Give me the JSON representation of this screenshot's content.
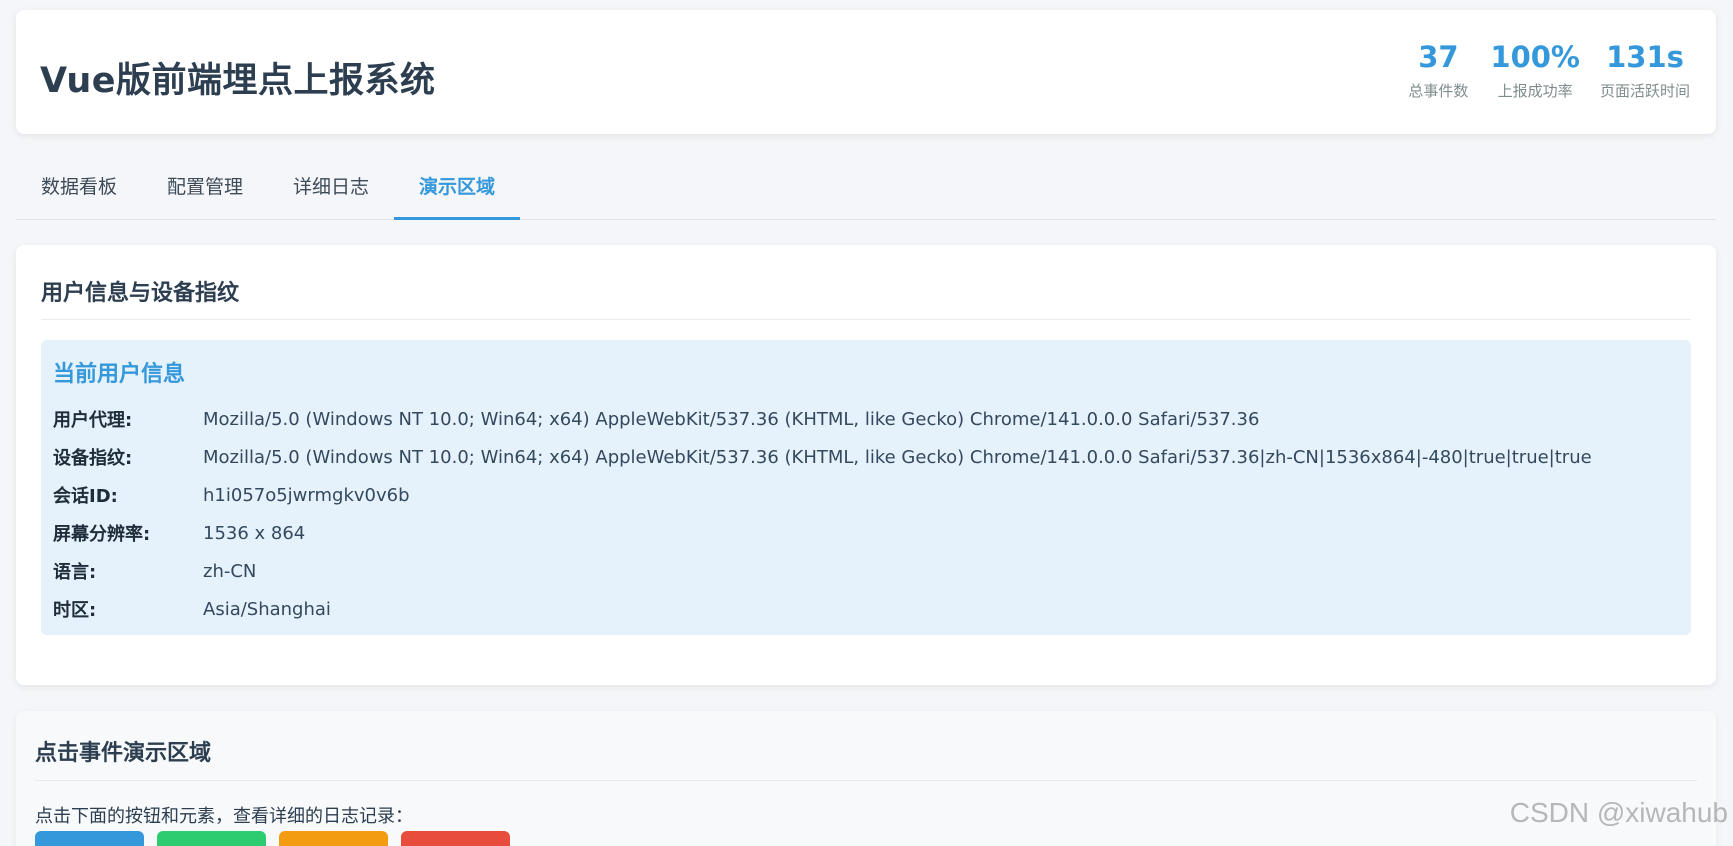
{
  "header": {
    "title": "Vue版前端埋点上报系统",
    "stats": [
      {
        "value": "37",
        "label": "总事件数"
      },
      {
        "value": "100%",
        "label": "上报成功率"
      },
      {
        "value": "131s",
        "label": "页面活跃时间"
      }
    ]
  },
  "tabs": [
    {
      "label": "数据看板"
    },
    {
      "label": "配置管理"
    },
    {
      "label": "详细日志"
    },
    {
      "label": "演示区域"
    }
  ],
  "active_tab": "演示区域",
  "user_card": {
    "title": "用户信息与设备指纹",
    "box_title": "当前用户信息",
    "rows": [
      {
        "label": "用户代理:",
        "value": "Mozilla/5.0 (Windows NT 10.0; Win64; x64) AppleWebKit/537.36 (KHTML, like Gecko) Chrome/141.0.0.0 Safari/537.36"
      },
      {
        "label": "设备指纹:",
        "value": "Mozilla/5.0 (Windows NT 10.0; Win64; x64) AppleWebKit/537.36 (KHTML, like Gecko) Chrome/141.0.0.0 Safari/537.36|zh-CN|1536x864|-480|true|true|true"
      },
      {
        "label": "会话ID:",
        "value": "h1i057o5jwrmgkv0v6b"
      },
      {
        "label": "屏幕分辨率:",
        "value": "1536 x 864"
      },
      {
        "label": "语言:",
        "value": "zh-CN"
      },
      {
        "label": "时区:",
        "value": "Asia/Shanghai"
      }
    ]
  },
  "click_card": {
    "title": "点击事件演示区域",
    "description": "点击下面的按钮和元素，查看详细的日志记录：",
    "button_colors": [
      "#3498db",
      "#2ecc71",
      "#f39c12",
      "#e74c3c"
    ]
  },
  "watermark": "CSDN @xiwahub",
  "colors": {
    "accent": "#3498db",
    "text": "#2c3e50",
    "info_bg": "#e5f1fb"
  }
}
